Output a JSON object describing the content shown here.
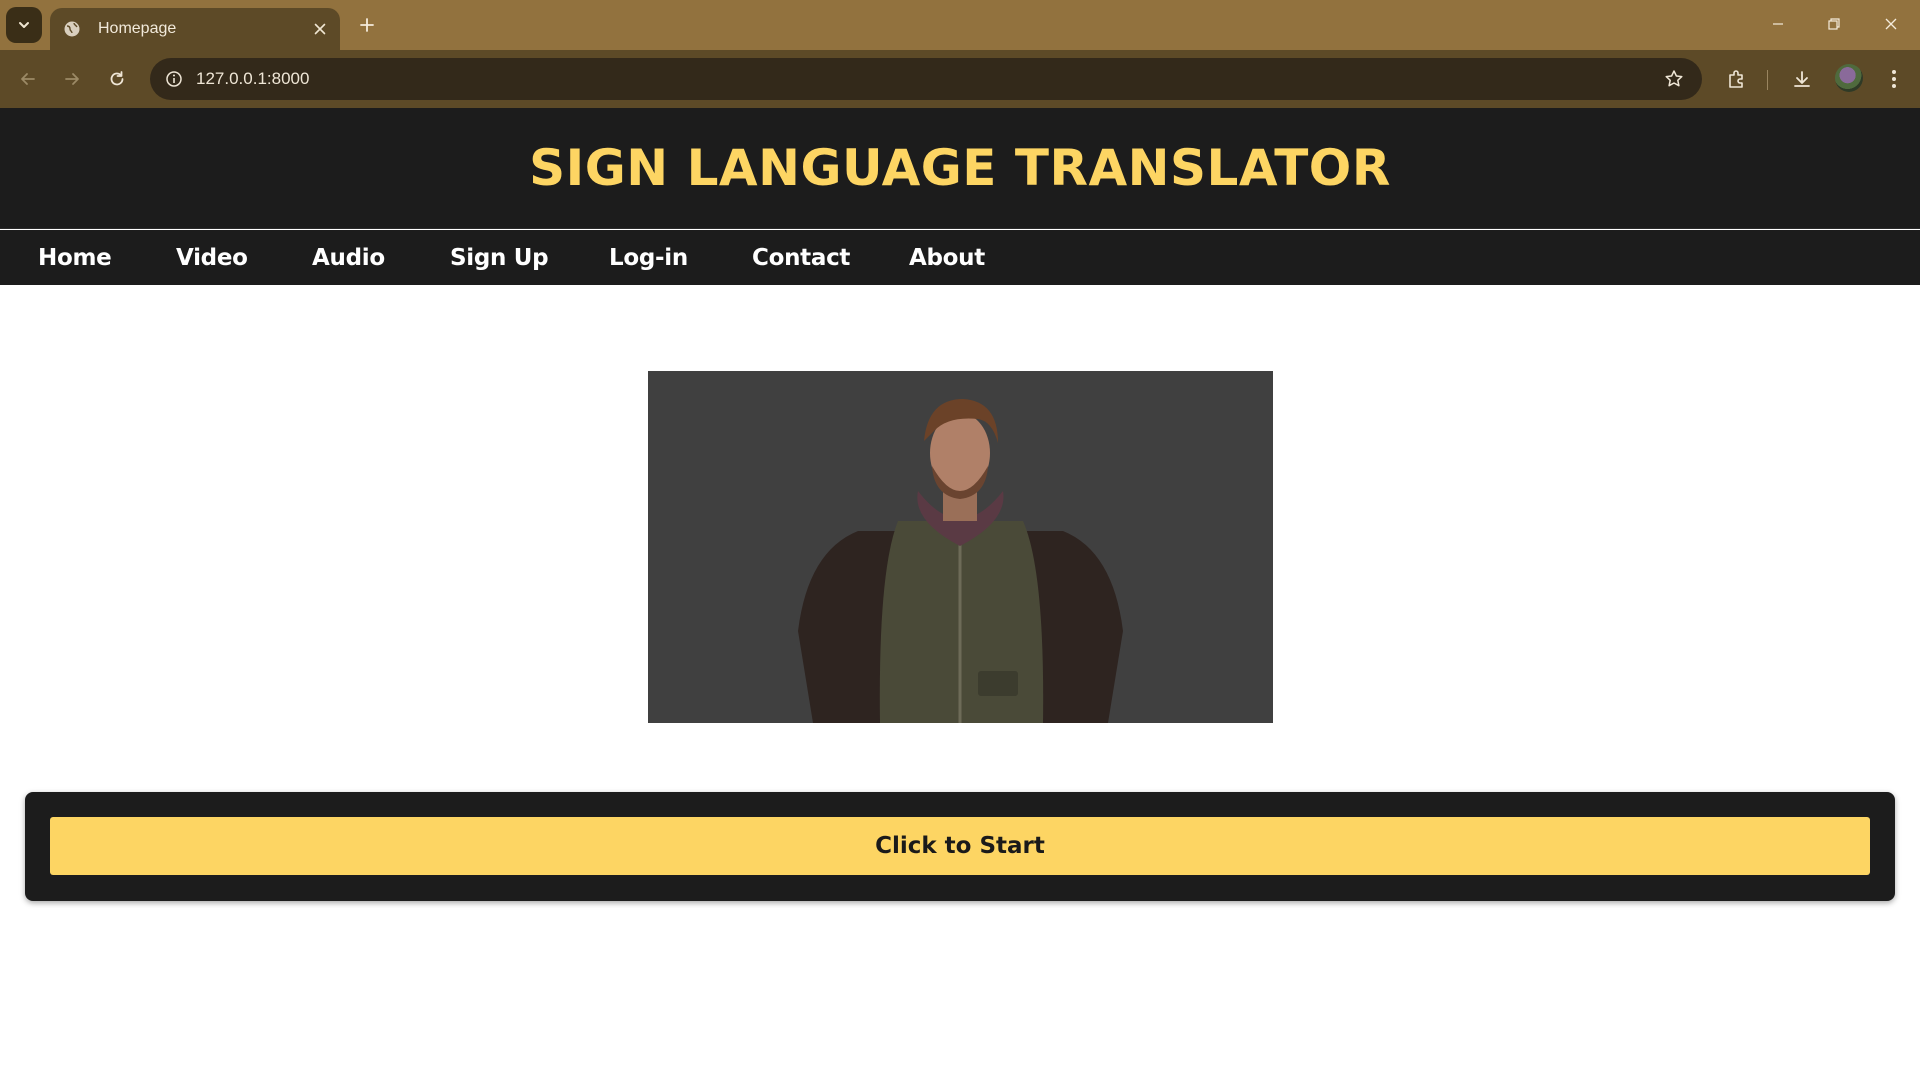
{
  "browser": {
    "tab_title": "Homepage",
    "url": "127.0.0.1:8000",
    "icons": [
      "tab-search-icon",
      "globe-icon",
      "close-icon",
      "plus-icon",
      "minimize-icon",
      "restore-icon",
      "window-close-icon",
      "back-icon",
      "forward-icon",
      "reload-icon",
      "site-info-icon",
      "star-icon",
      "extensions-icon",
      "download-icon",
      "profile-avatar",
      "kebab-menu-icon"
    ]
  },
  "header": {
    "title": "SIGN LANGUAGE TRANSLATOR",
    "title_color": "#fdd563",
    "background": "#1c1c1c"
  },
  "nav": {
    "items": [
      {
        "label": "Home"
      },
      {
        "label": "Video"
      },
      {
        "label": "Audio"
      },
      {
        "label": "Sign Up"
      },
      {
        "label": "Log-in"
      },
      {
        "label": "Contact"
      },
      {
        "label": "About"
      }
    ]
  },
  "main": {
    "start_button_label": "Click to Start",
    "accent_color": "#fdd563"
  }
}
